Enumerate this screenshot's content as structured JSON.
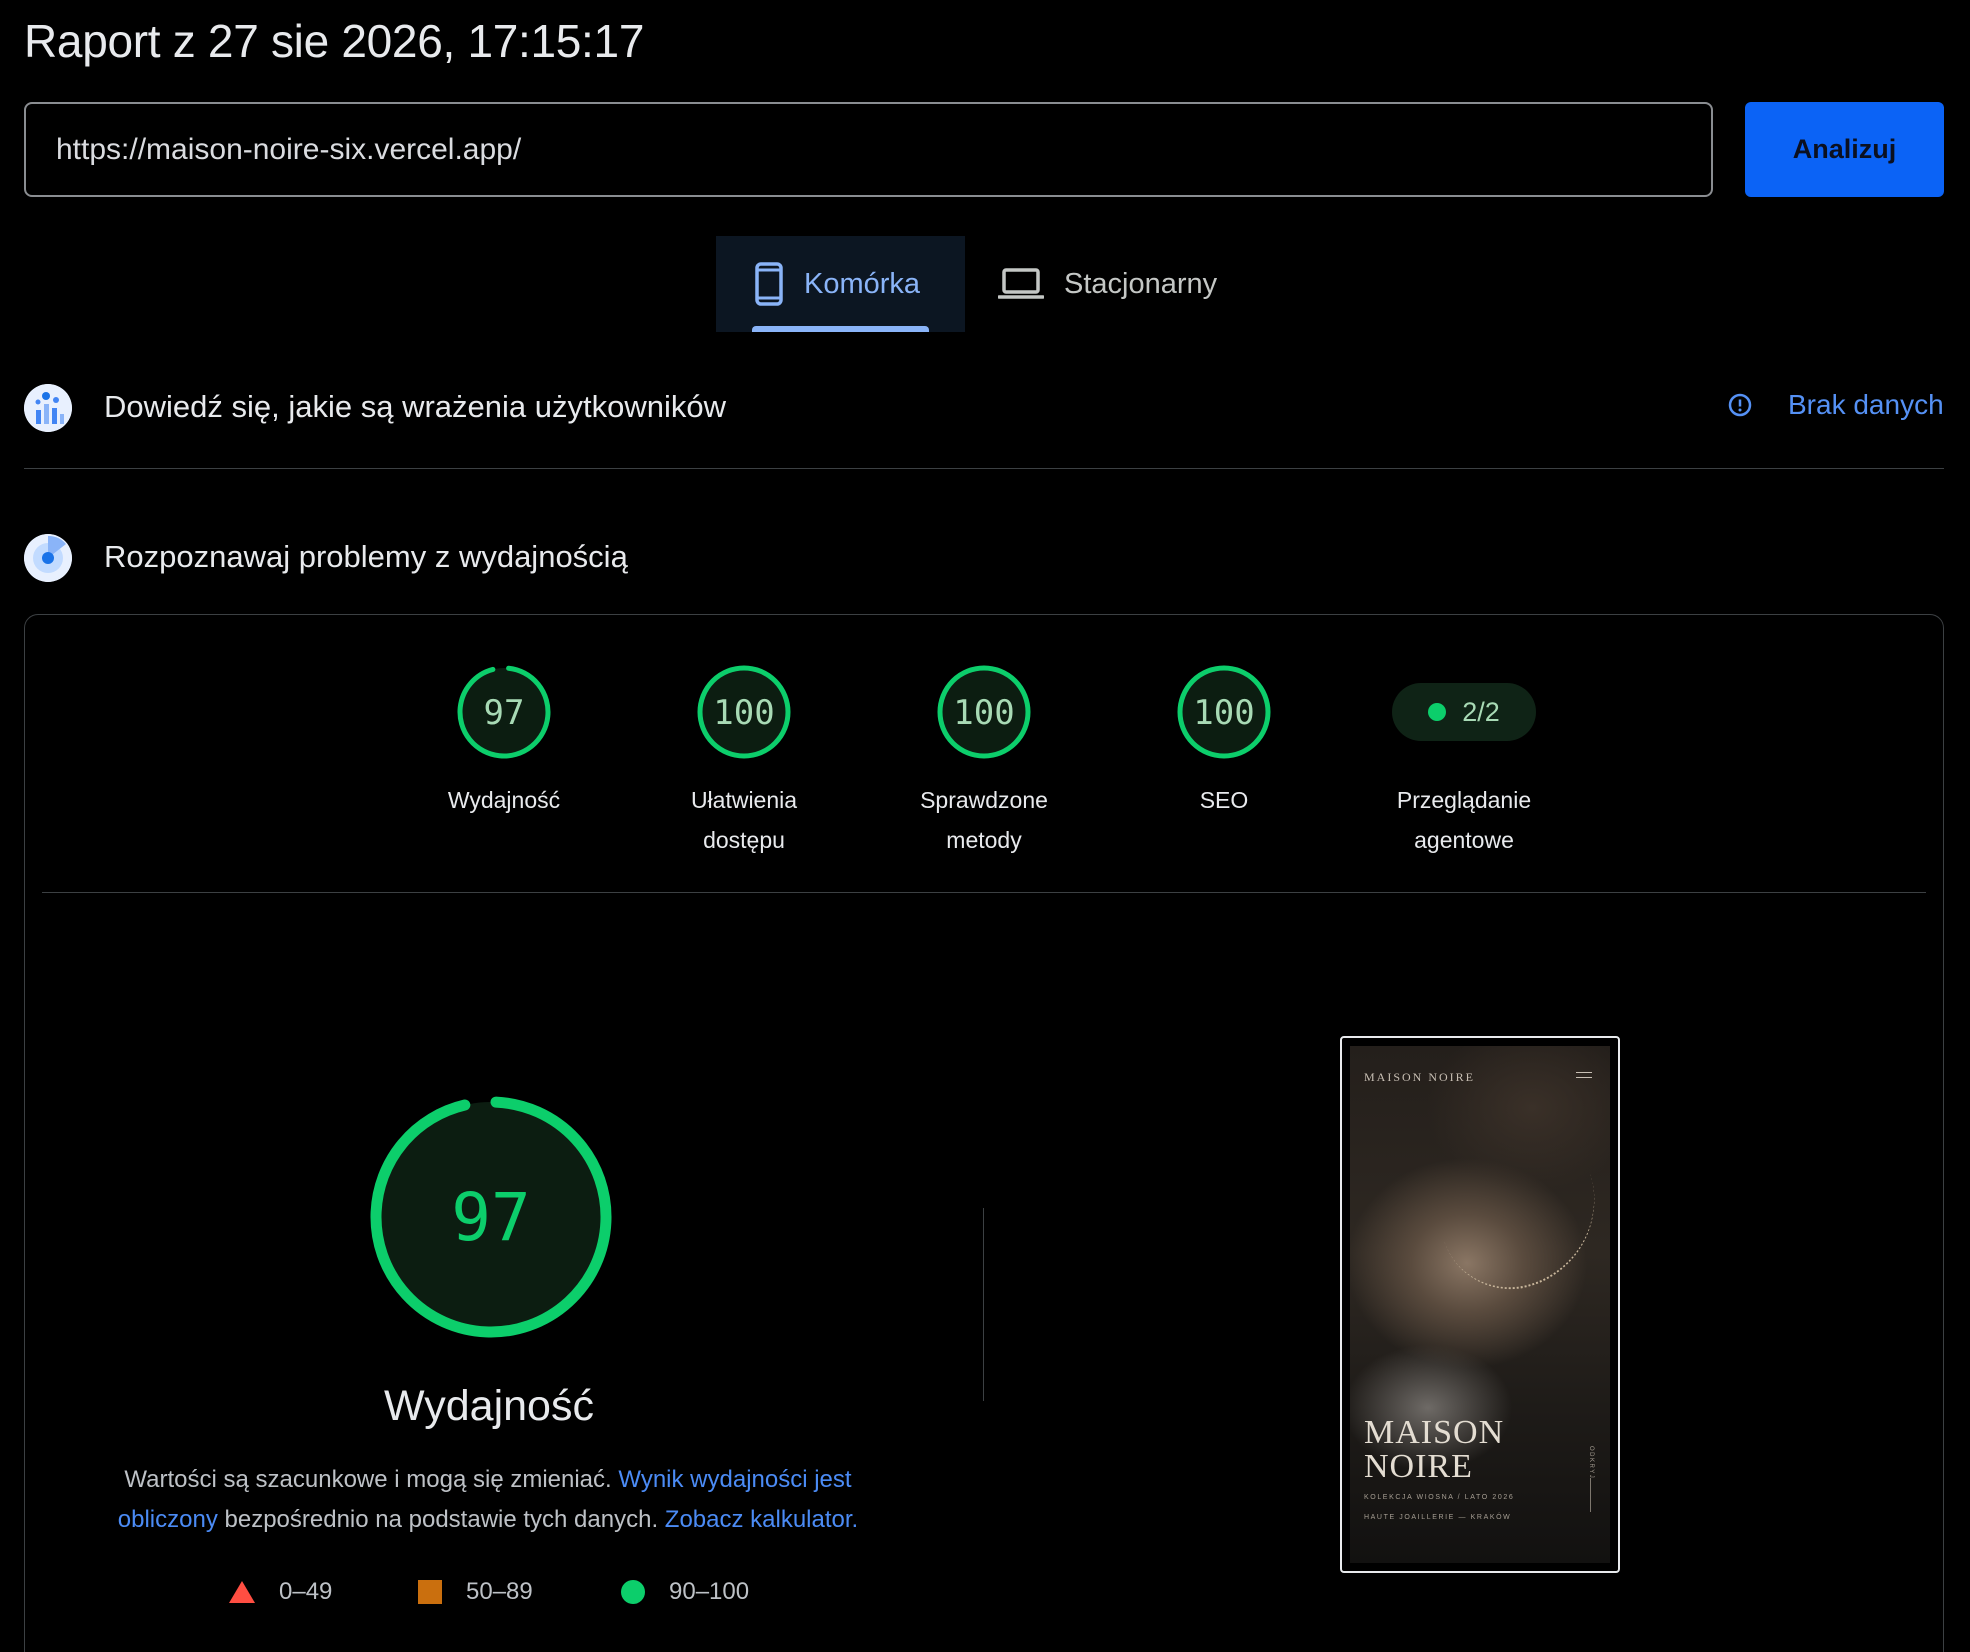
{
  "header": {
    "title": "Raport z 27 sie 2026, 17:15:17",
    "url_value": "https://maison-noire-six.vercel.app/",
    "analyze_label": "Analizuj"
  },
  "tabs": [
    {
      "label": "Komórka",
      "icon": "smartphone-icon",
      "selected": true
    },
    {
      "label": "Stacjonarny",
      "icon": "laptop-icon",
      "selected": false
    }
  ],
  "sections": {
    "experience": {
      "title": "Dowiedź się, jakie są wrażenia użytkowników",
      "icon": "users-chart-icon",
      "status": "Brak danych",
      "status_icon": "info-icon"
    },
    "diagnose": {
      "title": "Rozpoznawaj problemy z wydajnością",
      "icon": "lighthouse-icon"
    }
  },
  "scores": [
    {
      "value": 97,
      "label_line1": "Wydajność",
      "label_line2": ""
    },
    {
      "value": 100,
      "label_line1": "Ułatwienia",
      "label_line2": "dostępu"
    },
    {
      "value": 100,
      "label_line1": "Sprawdzone",
      "label_line2": "metody"
    },
    {
      "value": 100,
      "label_line1": "SEO",
      "label_line2": ""
    }
  ],
  "agentic": {
    "value": "2/2",
    "label_line1": "Przeglądanie",
    "label_line2": "agentowe"
  },
  "performance": {
    "score": 97,
    "label": "Wydajność",
    "desc_part1": "Wartości są szacunkowe i mogą się zmieniać. ",
    "desc_link1": "Wynik wydajności jest obliczony",
    "desc_part2": " bezpośrednio na podstawie tych danych. ",
    "desc_link2": "Zobacz kalkulator",
    "desc_part3": "."
  },
  "legend": [
    {
      "range": "0–49",
      "color": "#ff4e42",
      "shape": "triangle"
    },
    {
      "range": "50–89",
      "color": "#ca6f0e",
      "shape": "square"
    },
    {
      "range": "90–100",
      "color": "#0cce6b",
      "shape": "circle"
    }
  ],
  "thumbnail": {
    "brand": "MAISON NOIRE",
    "hero_line1": "MAISON",
    "hero_line2": "NOIRE",
    "sub_line1": "KOLEKCJA WIOSNA / LATO 2026",
    "sub_line2": "HAUTE JOAILLERIE — KRAKÓW",
    "side_text": "ODKRYJ"
  },
  "colors": {
    "pass": "#0cce6b",
    "pass_text": "#0cce6b",
    "accent_blue": "#8ab4f8",
    "link_blue": "#4b8bf5",
    "button_blue": "#0b63f6"
  }
}
